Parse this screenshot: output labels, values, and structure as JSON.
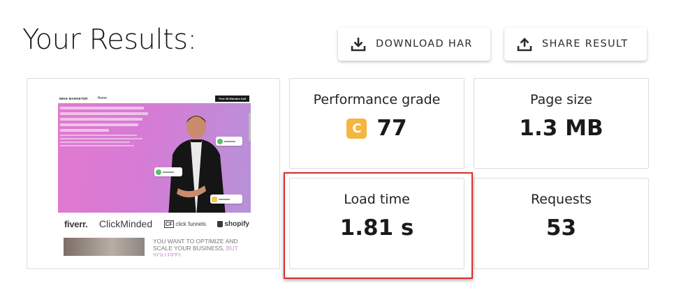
{
  "page": {
    "title": "Your Results:"
  },
  "actions": {
    "download_label": "DOWNLOAD HAR",
    "share_label": "SHARE RESULT"
  },
  "metrics": {
    "grade": {
      "label": "Performance grade",
      "letter": "C",
      "value": "77"
    },
    "size": {
      "label": "Page size",
      "value": "1.3 MB"
    },
    "load": {
      "label": "Load time",
      "value": "1.81 s"
    },
    "requests": {
      "label": "Requests",
      "value": "53"
    }
  },
  "screenshot": {
    "site_logo": "MIKE MARKETER",
    "nav_home": "Home",
    "cta": "Free 30 Minutes Call",
    "partners": [
      "fiverr.",
      "ClickMinded",
      "click funnels",
      "shopify"
    ],
    "body_text_part1": "YOU WANT TO OPTIMIZE AND SCALE YOUR BUSINESS,",
    "body_text_accent": "BUT YOU FEEL"
  },
  "colors": {
    "grade_badge": "#f4b63e",
    "highlight": "#d6302b"
  }
}
